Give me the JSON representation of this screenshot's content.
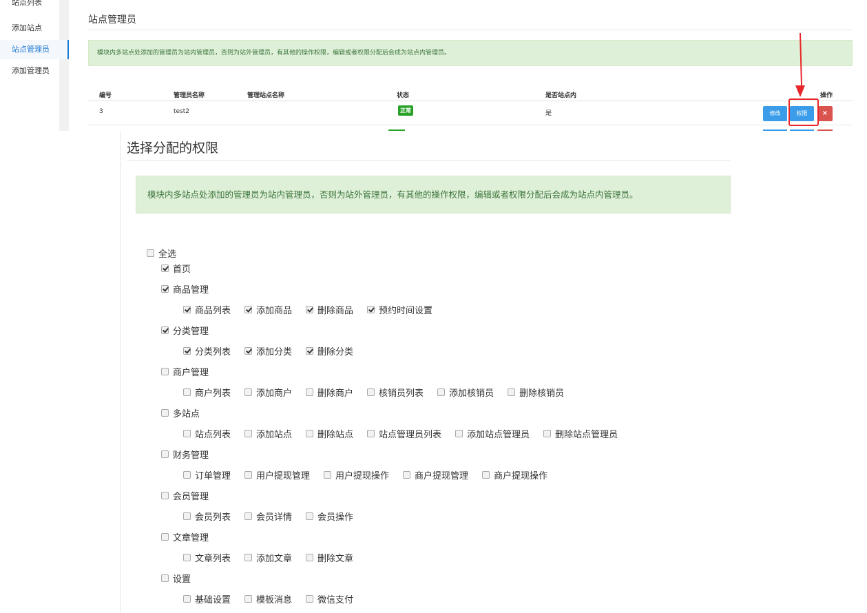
{
  "sidebar": {
    "items": [
      {
        "label": "站点列表",
        "active": false
      },
      {
        "label": "添加站点",
        "active": false
      },
      {
        "label": "站点管理员",
        "active": true
      },
      {
        "label": "添加管理员",
        "active": false
      }
    ]
  },
  "page": {
    "title": "站点管理员",
    "notice": "模块内多站点处添加的管理员为站内管理员，否则为站外管理员，有其他的操作权限，编辑或者权限分配后会成为站点内管理员。"
  },
  "table": {
    "headers": {
      "id": "编号",
      "name": "管理员名称",
      "site": "管理站点名称",
      "status": "状态",
      "inside": "是否站点内",
      "actions": "操作"
    },
    "rows": [
      {
        "id": "3",
        "name": "test2",
        "site": "",
        "status": "正常",
        "inside": "是",
        "edit": "修改",
        "perm": "权限",
        "delete": "×"
      }
    ]
  },
  "permissions": {
    "title": "选择分配的权限",
    "notice": "模块内多站点处添加的管理员为站内管理员，否则为站外管理员，有其他的操作权限，编辑或者权限分配后会成为站点内管理员。",
    "select_all": {
      "label": "全选",
      "checked": false
    },
    "groups": [
      {
        "label": "首页",
        "checked": true,
        "children": []
      },
      {
        "label": "商品管理",
        "checked": true,
        "children": [
          {
            "label": "商品列表",
            "checked": true
          },
          {
            "label": "添加商品",
            "checked": true
          },
          {
            "label": "删除商品",
            "checked": true
          },
          {
            "label": "预约时间设置",
            "checked": true
          }
        ]
      },
      {
        "label": "分类管理",
        "checked": true,
        "children": [
          {
            "label": "分类列表",
            "checked": true
          },
          {
            "label": "添加分类",
            "checked": true
          },
          {
            "label": "删除分类",
            "checked": true
          }
        ]
      },
      {
        "label": "商户管理",
        "checked": false,
        "children": [
          {
            "label": "商户列表",
            "checked": false
          },
          {
            "label": "添加商户",
            "checked": false
          },
          {
            "label": "删除商户",
            "checked": false
          },
          {
            "label": "核销员列表",
            "checked": false
          },
          {
            "label": "添加核销员",
            "checked": false
          },
          {
            "label": "删除核销员",
            "checked": false
          }
        ]
      },
      {
        "label": "多站点",
        "checked": false,
        "children": [
          {
            "label": "站点列表",
            "checked": false
          },
          {
            "label": "添加站点",
            "checked": false
          },
          {
            "label": "删除站点",
            "checked": false
          },
          {
            "label": "站点管理员列表",
            "checked": false
          },
          {
            "label": "添加站点管理员",
            "checked": false
          },
          {
            "label": "删除站点管理员",
            "checked": false
          }
        ]
      },
      {
        "label": "财务管理",
        "checked": false,
        "children": [
          {
            "label": "订单管理",
            "checked": false
          },
          {
            "label": "用户提现管理",
            "checked": false
          },
          {
            "label": "用户提现操作",
            "checked": false
          },
          {
            "label": "商户提现管理",
            "checked": false
          },
          {
            "label": "商户提现操作",
            "checked": false
          }
        ]
      },
      {
        "label": "会员管理",
        "checked": false,
        "children": [
          {
            "label": "会员列表",
            "checked": false
          },
          {
            "label": "会员详情",
            "checked": false
          },
          {
            "label": "会员操作",
            "checked": false
          }
        ]
      },
      {
        "label": "文章管理",
        "checked": false,
        "children": [
          {
            "label": "文章列表",
            "checked": false
          },
          {
            "label": "添加文章",
            "checked": false
          },
          {
            "label": "删除文章",
            "checked": false
          }
        ]
      },
      {
        "label": "设置",
        "checked": false,
        "children": [
          {
            "label": "基础设置",
            "checked": false
          },
          {
            "label": "模板消息",
            "checked": false
          },
          {
            "label": "微信支付",
            "checked": false
          }
        ]
      }
    ]
  },
  "colors": {
    "accent": "#1f78d1",
    "button_blue": "#3b9de9",
    "button_red": "#d9534f",
    "status_green": "#2aa22a",
    "notice_bg": "#dff0d8",
    "notice_text": "#3c763d",
    "annotation_red": "#e8262a"
  }
}
